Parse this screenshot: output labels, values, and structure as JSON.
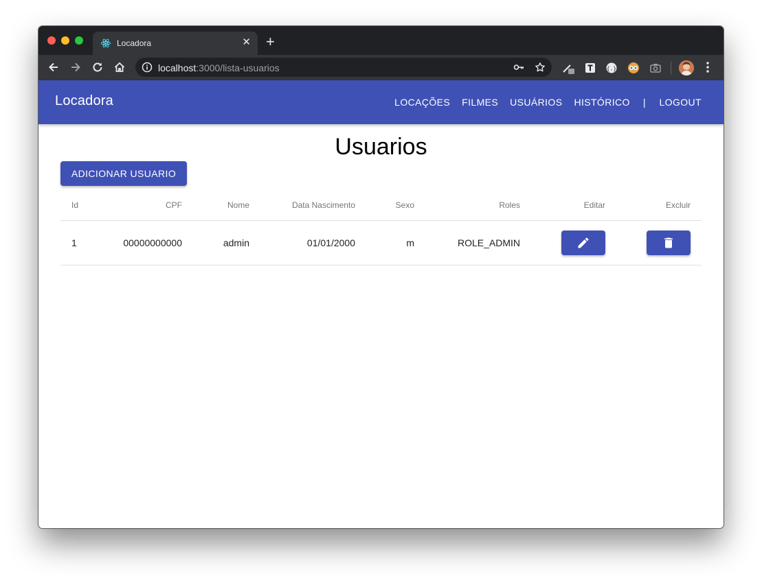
{
  "browser": {
    "tab_title": "Locadora",
    "new_tab_symbol": "+",
    "close_symbol": "✕",
    "url_host": "localhost",
    "url_path": ":3000/lista-usuarios"
  },
  "navbar": {
    "brand": "Locadora",
    "items": [
      "LOCAÇÕES",
      "FILMES",
      "USUÁRIOS",
      "HISTÓRICO"
    ],
    "divider": "|",
    "logout": "LOGOUT"
  },
  "page": {
    "title": "Usuarios",
    "add_button": "ADICIONAR USUARIO"
  },
  "table": {
    "headers": {
      "id": "Id",
      "cpf": "CPF",
      "nome": "Nome",
      "data_nascimento": "Data Nascimento",
      "sexo": "Sexo",
      "roles": "Roles",
      "editar": "Editar",
      "excluir": "Excluir"
    },
    "rows": [
      {
        "id": "1",
        "cpf": "00000000000",
        "nome": "admin",
        "data_nascimento": "01/01/2000",
        "sexo": "m",
        "roles": "ROLE_ADMIN"
      }
    ]
  },
  "icons": {
    "edit": "pencil-icon",
    "delete": "trash-icon"
  },
  "colors": {
    "primary": "#3f51b5",
    "browser_dark": "#202124",
    "browser_toolbar": "#35363a"
  }
}
